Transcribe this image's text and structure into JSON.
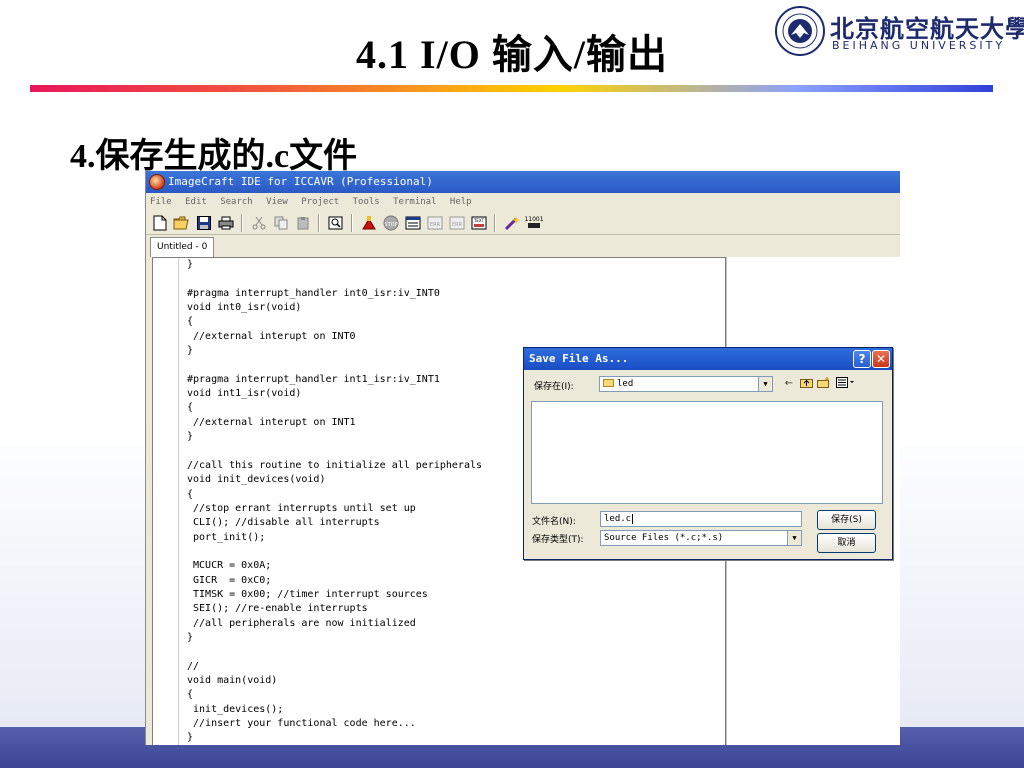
{
  "slide": {
    "title": "4.1 I/O 输入/输出",
    "heading": "4.保存生成的.c文件",
    "logo": {
      "chinese_name": "北京航空航天大學",
      "english_name": "BEIHANG UNIVERSITY"
    }
  },
  "ide": {
    "window_title": "ImageCraft IDE for ICCAVR (Professional)",
    "menu": [
      "File",
      "Edit",
      "Search",
      "View",
      "Project",
      "Tools",
      "Terminal",
      "Help"
    ],
    "toolbar_icons": [
      "new-file-icon",
      "open-folder-icon",
      "save-icon",
      "print-icon",
      "cut-icon",
      "copy-icon",
      "paste-icon",
      "find-icon",
      "build-icon",
      "stop-icon",
      "compile-icon",
      "err-icon",
      "errs-icon",
      "term-icon",
      "wizard-icon",
      "bits-icon"
    ],
    "tab_label": "Untitled - 0",
    "code_lines": [
      "}",
      "",
      "#pragma interrupt_handler int0_isr:iv_INT0",
      "void int0_isr(void)",
      "{",
      " //external interupt on INT0",
      "}",
      "",
      "#pragma interrupt_handler int1_isr:iv_INT1",
      "void int1_isr(void)",
      "{",
      " //external interupt on INT1",
      "}",
      "",
      "//call this routine to initialize all peripherals",
      "void init_devices(void)",
      "{",
      " //stop errant interrupts until set up",
      " CLI(); //disable all interrupts",
      " port_init();",
      "",
      " MCUCR = 0x0A;",
      " GICR  = 0xC0;",
      " TIMSK = 0x00; //timer interrupt sources",
      " SEI(); //re-enable interrupts",
      " //all peripherals are now initialized",
      "}",
      "",
      "//",
      "void main(void)",
      "{",
      " init_devices();",
      " //insert your functional code here...",
      "}"
    ]
  },
  "save_dialog": {
    "title": "Save File As...",
    "help_label": "?",
    "close_label": "✕",
    "save_in_label": "保存在(I):",
    "save_in_value": "led",
    "filename_label": "文件名(N):",
    "filename_value": "led.c",
    "filetype_label": "保存类型(T):",
    "filetype_value": "Source Files (*.c;*.s)",
    "save_button": "保存(S)",
    "cancel_button": "取消"
  }
}
